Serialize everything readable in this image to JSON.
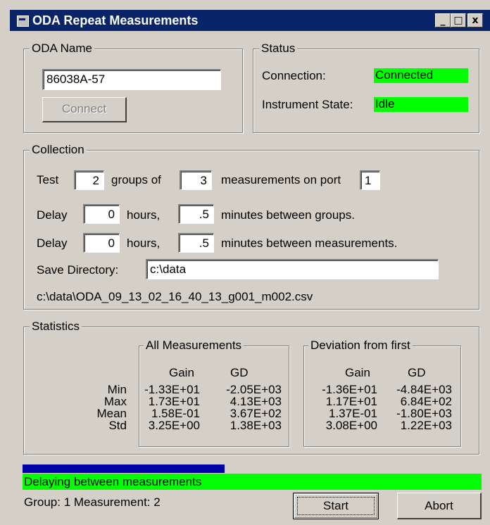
{
  "window": {
    "title": "ODA Repeat Measurements",
    "minimize": "_",
    "maximize": "□",
    "close": "x"
  },
  "oda_name": {
    "legend": "ODA Name",
    "value": "86038A-57",
    "connect_label": "Connect"
  },
  "status": {
    "legend": "Status",
    "connection_label": "Connection:",
    "connection_value": "Connected",
    "state_label": "Instrument State:",
    "state_value": "Idle",
    "indicator_color": "#00ff00"
  },
  "collection": {
    "legend": "Collection",
    "test_label": "Test",
    "groups_value": "2",
    "groups_of_label": "groups of",
    "measurements_value": "3",
    "measurements_on_port_label": "measurements on port",
    "port_value": "1",
    "delay_label": "Delay",
    "group_delay_hours": "0",
    "hours_label": "hours,",
    "group_delay_minutes": ".5",
    "minutes_between_groups_label": "minutes between groups.",
    "meas_delay_hours": "0",
    "meas_delay_minutes": ".5",
    "minutes_between_measurements_label": "minutes between measurements.",
    "save_dir_label": "Save Directory:",
    "save_dir_value": "c:\\data",
    "output_file": "c:\\data\\ODA_09_13_02_16_40_13_g001_m002.csv"
  },
  "statistics": {
    "legend": "Statistics",
    "row_labels": [
      "Min",
      "Max",
      "Mean",
      "Std"
    ],
    "all": {
      "legend": "All Measurements",
      "gain_header": "Gain",
      "gd_header": "GD",
      "gain": [
        "-1.33E+01",
        "1.73E+01",
        "1.58E-01",
        "3.25E+00"
      ],
      "gd": [
        "-2.05E+03",
        "4.13E+03",
        "3.67E+02",
        "1.38E+03"
      ]
    },
    "deviation": {
      "legend": "Deviation from first",
      "gain_header": "Gain",
      "gd_header": "GD",
      "gain": [
        "-1.36E+01",
        "1.17E+01",
        "1.37E-01",
        "3.08E+00"
      ],
      "gd": [
        "-4.84E+03",
        "6.84E+02",
        "-1.80E+03",
        "1.22E+03"
      ]
    }
  },
  "progress": {
    "fraction": 0.44,
    "color": "#0000a8"
  },
  "status_message": "Delaying between measurements",
  "counter_text": "Group: 1 Measurement: 2",
  "buttons": {
    "start": "Start",
    "abort": "Abort"
  }
}
